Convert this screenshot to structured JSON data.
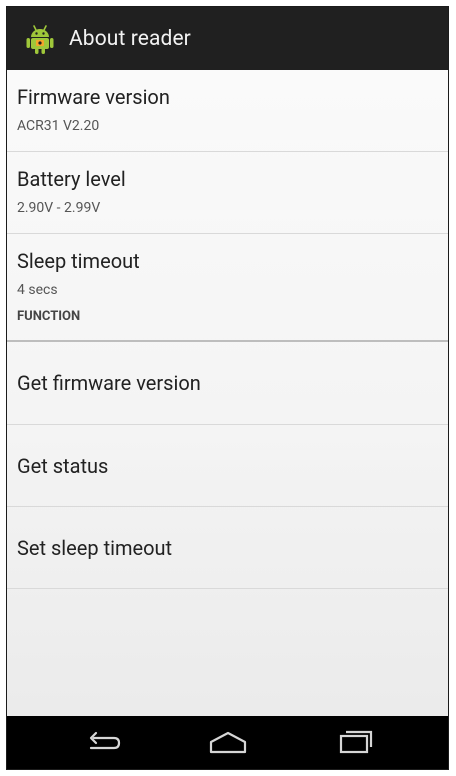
{
  "action_bar": {
    "title": "About reader",
    "icon": "android-icon"
  },
  "preferences": [
    {
      "title": "Firmware version",
      "summary": "ACR31 V2.20"
    },
    {
      "title": "Battery level",
      "summary": "2.90V - 2.99V"
    },
    {
      "title": "Sleep timeout",
      "summary": "4 secs"
    }
  ],
  "function_category": {
    "label": "FUNCTION",
    "items": [
      {
        "title": "Get firmware version"
      },
      {
        "title": "Get status"
      },
      {
        "title": "Set sleep timeout"
      }
    ]
  },
  "nav_bar": {
    "back_icon": "back-icon",
    "home_icon": "home-icon",
    "recents_icon": "recents-icon"
  },
  "colors": {
    "action_bar": "#202020",
    "nav_bar": "#000000",
    "divider": "#d9d9d9",
    "android_green": "#9fc73a"
  }
}
